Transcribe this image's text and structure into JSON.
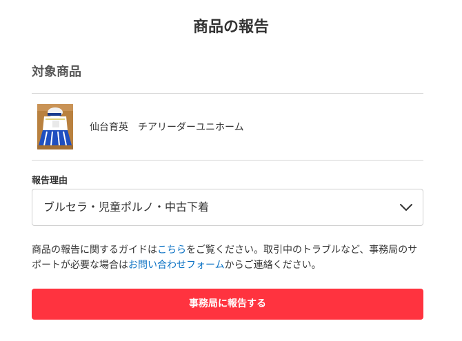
{
  "header": {
    "title": "商品の報告"
  },
  "target": {
    "section_title": "対象商品",
    "product_name": "仙台育英　チアリーダーユニホーム",
    "thumbnail_icon": "product-thumbnail-image"
  },
  "reason": {
    "label": "報告理由",
    "selected": "ブルセラ・児童ポルノ・中古下着",
    "chevron_icon": "chevron-down-icon"
  },
  "guide": {
    "text_1": "商品の報告に関するガイドは",
    "link_1": "こちら",
    "text_2": "をご覧ください。取引中のトラブルなど、事務局のサポートが必要な場合は",
    "link_2": "お問い合わせフォーム",
    "text_3": "からご連絡ください。"
  },
  "submit": {
    "label": "事務局に報告する"
  },
  "colors": {
    "accent": "#ff333f",
    "link": "#0b72c4",
    "text": "#333333",
    "divider": "#d6d6d6"
  }
}
